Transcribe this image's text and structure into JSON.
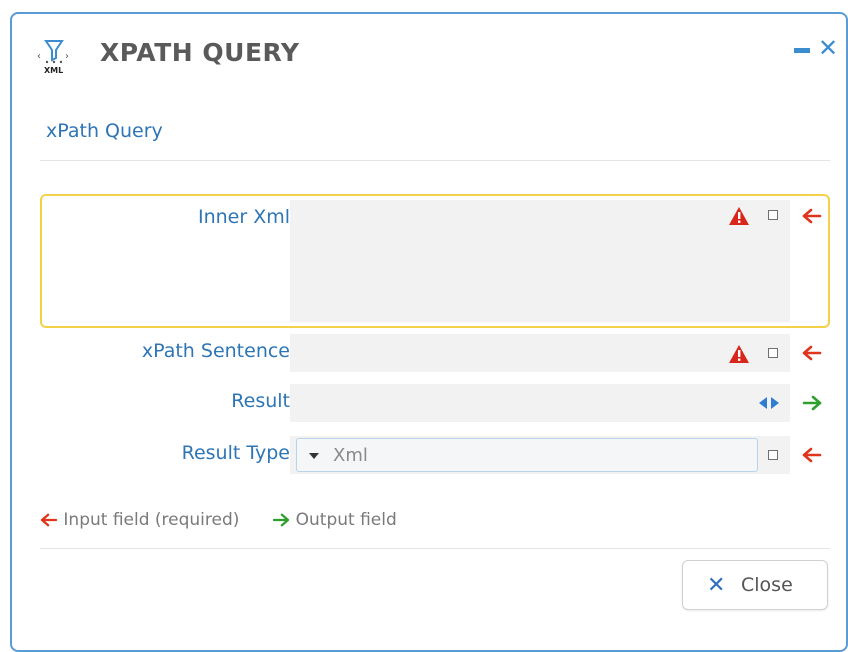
{
  "dialog": {
    "title": "XPATH QUERY",
    "icon": "xml-filter-icon",
    "window_controls": {
      "minimize_icon": "minimize-icon",
      "close_icon": "close-icon"
    }
  },
  "section": {
    "title": "xPath Query"
  },
  "fields": {
    "inner_xml": {
      "label": "Inner Xml",
      "value": "",
      "required": true,
      "status": "warning"
    },
    "xpath_sentence": {
      "label": "xPath Sentence",
      "value": "",
      "required": true,
      "status": "warning"
    },
    "result": {
      "label": "Result",
      "value": "",
      "direction": "output"
    },
    "result_type": {
      "label": "Result Type",
      "selected": "Xml"
    }
  },
  "legend": {
    "input": "Input field (required)",
    "output": "Output field"
  },
  "footer": {
    "close_label": "Close"
  },
  "colors": {
    "accent": "#2e75b6",
    "input_arrow": "#e0341c",
    "output_arrow": "#2ea02e",
    "warning": "#d9261c",
    "highlight_border": "#f3d24a"
  }
}
